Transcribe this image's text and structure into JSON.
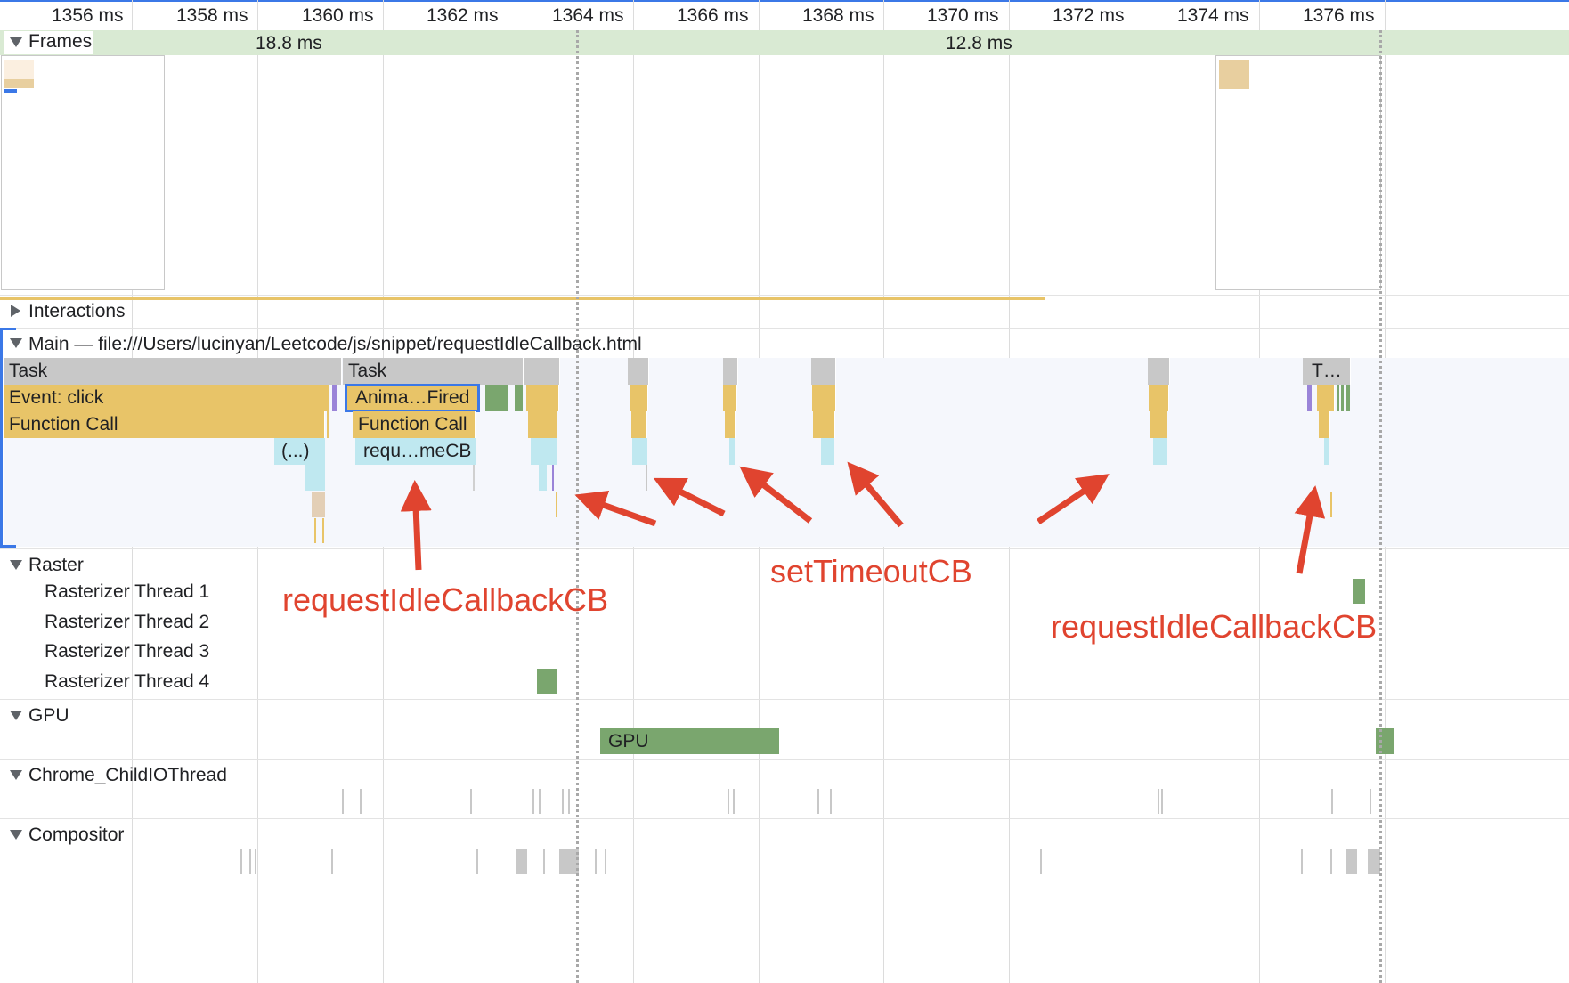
{
  "ruler": {
    "ticks": [
      "1356 ms",
      "1358 ms",
      "1360 ms",
      "1362 ms",
      "1364 ms",
      "1366 ms",
      "1368 ms",
      "1370 ms",
      "1372 ms",
      "1374 ms",
      "1376 ms"
    ]
  },
  "tracks": {
    "frames": {
      "label": "Frames",
      "frame_times": [
        "18.8 ms",
        "12.8 ms"
      ]
    },
    "interactions": {
      "label": "Interactions"
    },
    "main": {
      "label": "Main — file:///Users/lucinyan/Leetcode/js/snippet/requestIdleCallback.html"
    },
    "raster": {
      "label": "Raster",
      "threads": [
        "Rasterizer Thread 1",
        "Rasterizer Thread 2",
        "Rasterizer Thread 3",
        "Rasterizer Thread 4"
      ]
    },
    "gpu": {
      "label": "GPU",
      "bar_label": "GPU"
    },
    "childio": {
      "label": "Chrome_ChildIOThread"
    },
    "compositor": {
      "label": "Compositor"
    }
  },
  "flame": {
    "task_1": "Task",
    "task_2": "Task",
    "task_end": "T…",
    "event_click": "Event: click",
    "anim_fired": "Anima…Fired",
    "function_call_1": "Function Call",
    "function_call_2": "Function Call",
    "anon": "(...)",
    "raf_cb": "requ…meCB"
  },
  "annotations": {
    "left": "requestIdleCallbackCB",
    "middle": "setTimeoutCB",
    "right": "requestIdleCallbackCB"
  },
  "colors": {
    "annotation": "#e0442f",
    "scripting": "#e8c468",
    "task": "#c8c8c8",
    "painting": "#7aa66e",
    "frames_bg": "#d9ead3",
    "selection": "#3b78e7"
  }
}
